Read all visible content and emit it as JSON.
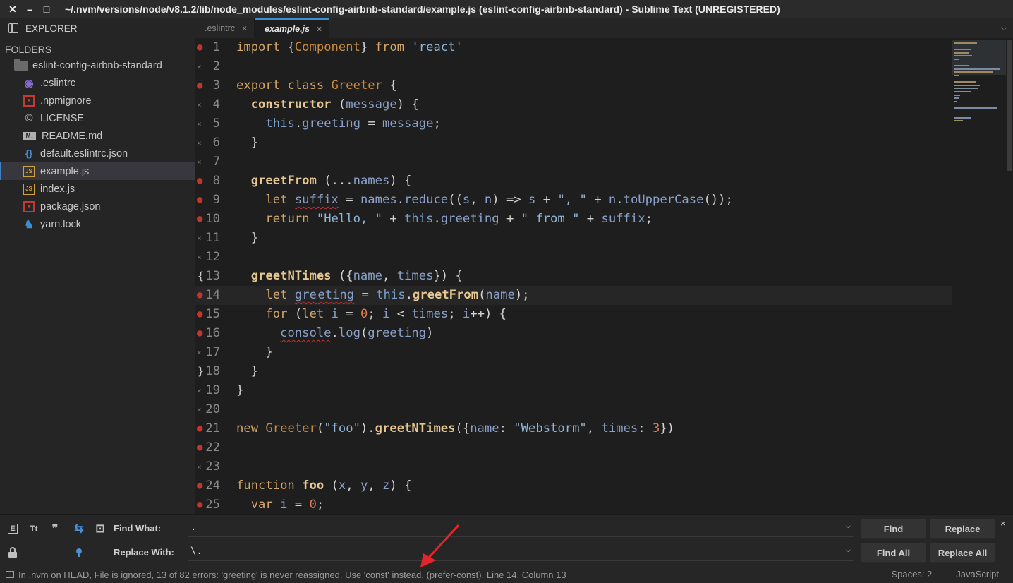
{
  "window": {
    "close_glyph": "✕",
    "minimize_glyph": "–",
    "maximize_glyph": "□",
    "title": "~/.nvm/versions/node/v8.1.2/lib/node_modules/eslint-config-airbnb-standard/example.js (eslint-config-airbnb-standard) - Sublime Text (UNREGISTERED)"
  },
  "sidebar": {
    "header": "EXPLORER",
    "folders_label": "FOLDERS",
    "root_folder": "eslint-config-airbnb-standard",
    "files": [
      {
        "name": ".eslintrc",
        "icon": "eslint-icon",
        "color": "#8a6bd6",
        "glyph": "◉"
      },
      {
        "name": ".npmignore",
        "icon": "npm-icon",
        "color": "#c23b32",
        "glyph": "■"
      },
      {
        "name": "LICENSE",
        "icon": "license-icon",
        "color": "#b0b0b0",
        "glyph": "©"
      },
      {
        "name": "README.md",
        "icon": "markdown-icon",
        "color": "#b0b0b0",
        "glyph": "M↓"
      },
      {
        "name": "default.eslintrc.json",
        "icon": "json-icon",
        "color": "#4a90d9",
        "glyph": "{}"
      },
      {
        "name": "example.js",
        "icon": "js-icon",
        "color": "#d0a43a",
        "glyph": "JS"
      },
      {
        "name": "index.js",
        "icon": "js-icon",
        "color": "#d0a43a",
        "glyph": "JS"
      },
      {
        "name": "package.json",
        "icon": "npm-icon",
        "color": "#c23b32",
        "glyph": "■"
      },
      {
        "name": "yarn.lock",
        "icon": "yarn-icon",
        "color": "#3a8fd1",
        "glyph": "♞"
      }
    ],
    "active_index": 5
  },
  "tabs": [
    {
      "label": ".eslintrc",
      "active": false
    },
    {
      "label": "example.js",
      "active": true
    }
  ],
  "tab_close_glyph": "×",
  "tab_dropdown_glyph": "⌵",
  "editor": {
    "current_line": 14,
    "markers": {
      "1": "dot",
      "2": "x",
      "3": "dot",
      "4": "x",
      "5": "x",
      "6": "x",
      "7": "x",
      "8": "dot",
      "9": "dot",
      "10": "dot",
      "11": "x",
      "12": "x",
      "13": "fold-open",
      "14": "dot",
      "15": "dot",
      "16": "dot",
      "17": "x",
      "18": "fold-close",
      "19": "x",
      "20": "x",
      "21": "dot",
      "22": "dot",
      "23": "x",
      "24": "dot",
      "25": "dot"
    },
    "lines": [
      "import {Component} from 'react'",
      "",
      "export class Greeter {",
      "  constructor (message) {",
      "    this.greeting = message;",
      "  }",
      "",
      "  greetFrom (...names) {",
      "    let suffix = names.reduce((s, n) => s + \", \" + n.toUpperCase());",
      "    return \"Hello, \" + this.greeting + \" from \" + suffix;",
      "  }",
      "",
      "  greetNTimes ({name, times}) {",
      "    let greeting = this.greetFrom(name);",
      "    for (let i = 0; i < times; i++) {",
      "      console.log(greeting)",
      "    }",
      "  }",
      "}",
      "",
      "new Greeter(\"foo\").greetNTimes({name: \"Webstorm\", times: 3})",
      "",
      "",
      "function foo (x, y, z) {",
      "  var i = 0;"
    ]
  },
  "find": {
    "find_label": "Find What:",
    "replace_label": "Replace With:",
    "find_value": ".",
    "replace_value": "\\.",
    "dropdown_glyph": "⌵",
    "buttons": {
      "find": "Find",
      "replace": "Replace",
      "find_all": "Find All",
      "replace_all": "Replace All"
    },
    "close_glyph": "×",
    "option_glyphs": {
      "regex": "E",
      "case": "Tt",
      "whole_word": "❞",
      "wrap": "⇆",
      "in_selection": "⊡",
      "preserve_case": "🔒",
      "highlight": "⚲"
    }
  },
  "status": {
    "message": "In .nvm on HEAD, File is ignored, 13 of 82 errors: 'greeting' is never reassigned. Use 'const' instead. (prefer-const), Line 14, Column 13",
    "spaces": "Spaces: 2",
    "syntax": "JavaScript"
  },
  "colors": {
    "accent": "#3d8fd1",
    "error": "#d03030",
    "annotation_arrow": "#e0262a"
  }
}
